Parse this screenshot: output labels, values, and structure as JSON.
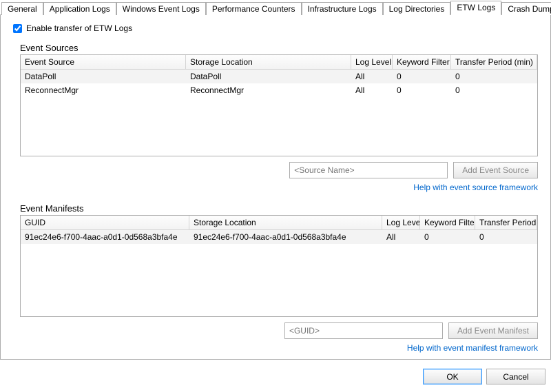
{
  "tabs": [
    "General",
    "Application Logs",
    "Windows Event Logs",
    "Performance Counters",
    "Infrastructure Logs",
    "Log Directories",
    "ETW Logs",
    "Crash Dumps"
  ],
  "active_tab_index": 6,
  "enable_checkbox": {
    "label": "Enable transfer of ETW Logs",
    "checked": true
  },
  "sources": {
    "label": "Event Sources",
    "headers": [
      "Event Source",
      "Storage Location",
      "Log Level",
      "Keyword Filter",
      "Transfer Period (min)"
    ],
    "rows": [
      {
        "source": "DataPoll",
        "storage": "DataPoll",
        "level": "All",
        "filter": "0",
        "period": "0"
      },
      {
        "source": "ReconnectMgr",
        "storage": "ReconnectMgr",
        "level": "All",
        "filter": "0",
        "period": "0"
      }
    ],
    "input_placeholder": "<Source Name>",
    "add_button": "Add Event Source",
    "help_link": "Help with event source framework"
  },
  "manifests": {
    "label": "Event Manifests",
    "headers": [
      "GUID",
      "Storage Location",
      "Log Level",
      "Keyword Filter",
      "Transfer Period (min)"
    ],
    "rows": [
      {
        "guid": "91ec24e6-f700-4aac-a0d1-0d568a3bfa4e",
        "storage": "91ec24e6-f700-4aac-a0d1-0d568a3bfa4e",
        "level": "All",
        "filter": "0",
        "period": "0"
      }
    ],
    "input_placeholder": "<GUID>",
    "add_button": "Add Event Manifest",
    "help_link": "Help with event manifest framework"
  },
  "dialog": {
    "ok": "OK",
    "cancel": "Cancel"
  }
}
